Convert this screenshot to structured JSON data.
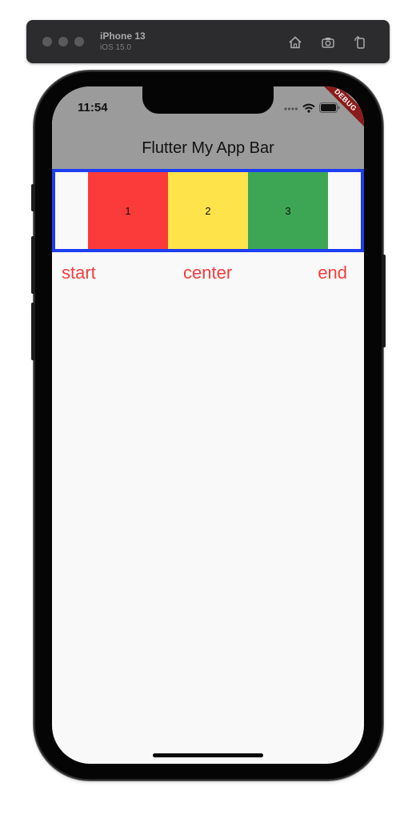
{
  "simulator": {
    "device_name": "iPhone 13",
    "os_version": "iOS 15.0",
    "toolbar_icons": [
      "home-icon",
      "screenshot-icon",
      "rotate-icon"
    ]
  },
  "status_bar": {
    "time": "11:54",
    "icons": [
      "cellular-icon",
      "wifi-icon",
      "battery-icon"
    ]
  },
  "debug_banner": "DEBUG",
  "app_bar": {
    "title": "Flutter My App Bar",
    "background": "#9b9b9b"
  },
  "row": {
    "border_color": "#1e3ef2",
    "boxes": [
      {
        "label": "1",
        "color": "#fb3a3a"
      },
      {
        "label": "2",
        "color": "#ffe34b"
      },
      {
        "label": "3",
        "color": "#3da655"
      }
    ]
  },
  "alignment_labels": {
    "start": "start",
    "center": "center",
    "end": "end",
    "color": "#f53d3d"
  }
}
